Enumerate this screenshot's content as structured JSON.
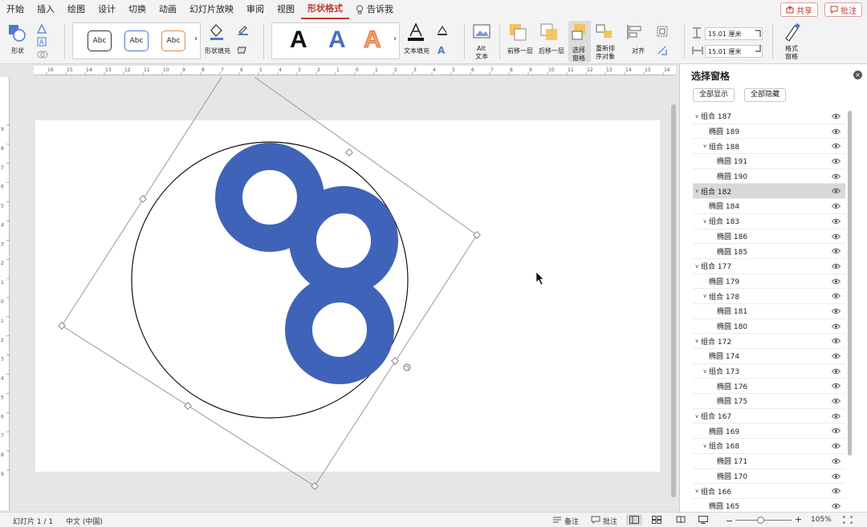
{
  "menu": {
    "tabs": [
      "开始",
      "插入",
      "绘图",
      "设计",
      "切换",
      "动画",
      "幻灯片放映",
      "审阅",
      "视图",
      "形状格式"
    ],
    "active_tab": "形状格式",
    "tell_me": "告诉我",
    "share": "共享",
    "comments": "批注"
  },
  "ribbon": {
    "shape_label": "形状",
    "style_samples": [
      "Abc",
      "Abc",
      "Abc"
    ],
    "shape_fill_label": "形状填充",
    "wordart_letters": [
      "A",
      "A",
      "A"
    ],
    "text_fill_label": "文本填充",
    "alt_text_line1": "Alt",
    "alt_text_line2": "文本",
    "bring_forward": "前移一层",
    "send_backward": "后移一层",
    "selection_pane_line1": "选择",
    "selection_pane_line2": "窗格",
    "reorder_line1": "重新排",
    "reorder_line2": "序对象",
    "align": "对齐",
    "height_value": "15.01 厘米",
    "width_value": "15.01 厘米",
    "format_pane_line1": "格式",
    "format_pane_line2": "窗格",
    "colors": {
      "accent": "#c0392b",
      "shape_blue": "#3f63b8"
    }
  },
  "ruler": {
    "h_numbers": [
      "16",
      "15",
      "14",
      "13",
      "12",
      "11",
      "10",
      "9",
      "8",
      "7",
      "6",
      "5",
      "4",
      "3",
      "2",
      "1",
      "0",
      "1",
      "2",
      "3",
      "4",
      "5",
      "6",
      "7",
      "8",
      "9",
      "10",
      "11",
      "12",
      "13",
      "14",
      "15",
      "16"
    ],
    "v_numbers": [
      "9",
      "8",
      "7",
      "6",
      "5",
      "4",
      "3",
      "2",
      "1",
      "0",
      "1",
      "2",
      "3",
      "4",
      "5",
      "6",
      "7",
      "8",
      "9"
    ]
  },
  "selection_pane": {
    "title": "选择窗格",
    "show_all": "全部显示",
    "hide_all": "全部隐藏",
    "items": [
      {
        "label": "组合 187",
        "level": 0,
        "group": true
      },
      {
        "label": "椭圆 189",
        "level": 1,
        "group": false
      },
      {
        "label": "组合 188",
        "level": 1,
        "group": true
      },
      {
        "label": "椭圆 191",
        "level": 2,
        "group": false
      },
      {
        "label": "椭圆 190",
        "level": 2,
        "group": false
      },
      {
        "label": "组合 182",
        "level": 0,
        "group": true,
        "selected": true
      },
      {
        "label": "椭圆 184",
        "level": 1,
        "group": false
      },
      {
        "label": "组合 183",
        "level": 1,
        "group": true
      },
      {
        "label": "椭圆 186",
        "level": 2,
        "group": false
      },
      {
        "label": "椭圆 185",
        "level": 2,
        "group": false
      },
      {
        "label": "组合 177",
        "level": 0,
        "group": true
      },
      {
        "label": "椭圆 179",
        "level": 1,
        "group": false
      },
      {
        "label": "组合 178",
        "level": 1,
        "group": true
      },
      {
        "label": "椭圆 181",
        "level": 2,
        "group": false
      },
      {
        "label": "椭圆 180",
        "level": 2,
        "group": false
      },
      {
        "label": "组合 172",
        "level": 0,
        "group": true
      },
      {
        "label": "椭圆 174",
        "level": 1,
        "group": false
      },
      {
        "label": "组合 173",
        "level": 1,
        "group": true
      },
      {
        "label": "椭圆 176",
        "level": 2,
        "group": false
      },
      {
        "label": "椭圆 175",
        "level": 2,
        "group": false
      },
      {
        "label": "组合 167",
        "level": 0,
        "group": true
      },
      {
        "label": "椭圆 169",
        "level": 1,
        "group": false
      },
      {
        "label": "组合 168",
        "level": 1,
        "group": true
      },
      {
        "label": "椭圆 171",
        "level": 2,
        "group": false
      },
      {
        "label": "椭圆 170",
        "level": 2,
        "group": false
      },
      {
        "label": "组合 166",
        "level": 0,
        "group": true
      },
      {
        "label": "椭圆 165",
        "level": 1,
        "group": false
      }
    ]
  },
  "status": {
    "slide_info": "幻灯片 1 / 1",
    "language": "中文 (中国)",
    "notes": "备注",
    "comments": "批注",
    "zoom": "105%"
  }
}
